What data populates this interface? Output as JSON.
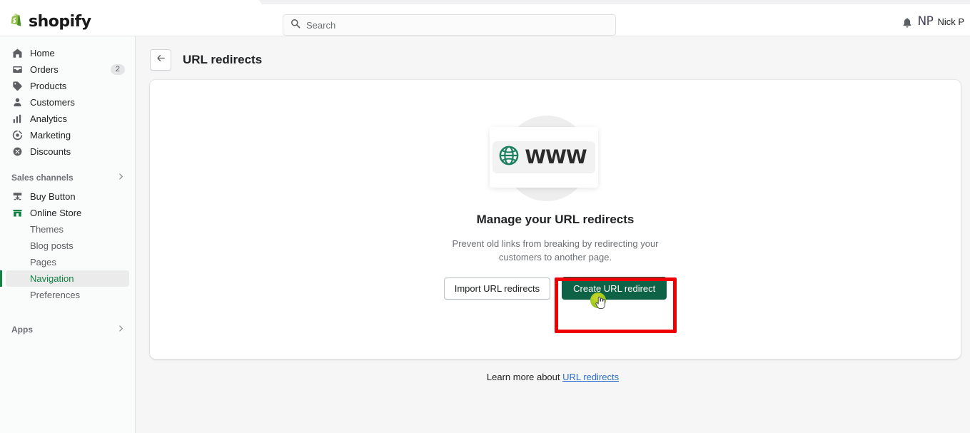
{
  "browser": {
    "tab_strip": ""
  },
  "topbar": {
    "brand": "shopify",
    "brand_icon": "shopify-bag-icon",
    "search": {
      "placeholder": "Search",
      "value": "",
      "icon": "search-icon"
    },
    "notifications_icon": "bell-icon",
    "user": {
      "initials": "NP",
      "name": "Nick P"
    }
  },
  "sidebar": {
    "items": [
      {
        "label": "Home",
        "icon": "home-icon",
        "badge": ""
      },
      {
        "label": "Orders",
        "icon": "orders-icon",
        "badge": "2"
      },
      {
        "label": "Products",
        "icon": "tag-icon",
        "badge": ""
      },
      {
        "label": "Customers",
        "icon": "person-icon",
        "badge": ""
      },
      {
        "label": "Analytics",
        "icon": "bar-chart-icon",
        "badge": ""
      },
      {
        "label": "Marketing",
        "icon": "marketing-target-icon",
        "badge": ""
      },
      {
        "label": "Discounts",
        "icon": "discount-percent-icon",
        "badge": ""
      }
    ],
    "sales_channels": {
      "title": "Sales channels",
      "chevron_icon": "chevron-right-icon",
      "items": [
        {
          "label": "Buy Button",
          "icon": "buy-button-icon"
        },
        {
          "label": "Online Store",
          "icon": "storefront-icon"
        }
      ]
    },
    "online_store_subitems": [
      {
        "label": "Themes",
        "active": false
      },
      {
        "label": "Blog posts",
        "active": false
      },
      {
        "label": "Pages",
        "active": false
      },
      {
        "label": "Navigation",
        "active": true
      },
      {
        "label": "Preferences",
        "active": false
      }
    ],
    "apps": {
      "title": "Apps",
      "chevron_icon": "chevron-right-icon"
    }
  },
  "page": {
    "back_icon": "arrow-left-icon",
    "title": "URL redirects",
    "empty_state": {
      "illustration_icon": "globe-www-icon",
      "illustration_text": "WWW",
      "title": "Manage your URL redirects",
      "description": "Prevent old links from breaking by redirecting your customers to another page.",
      "secondary_button": "Import URL redirects",
      "primary_button": "Create URL redirect"
    },
    "footer": {
      "text": "Learn more about",
      "link": "URL redirects"
    }
  },
  "annotation": {
    "highlight_color": "#ee0000",
    "click_target": "create-url-redirect-button",
    "cursor_icon": "pointing-hand-cursor"
  },
  "colors": {
    "brand_green": "#0e6245",
    "active_green": "#108043",
    "link_blue": "#2c6ecb",
    "page_bg": "#f6f6f7"
  }
}
